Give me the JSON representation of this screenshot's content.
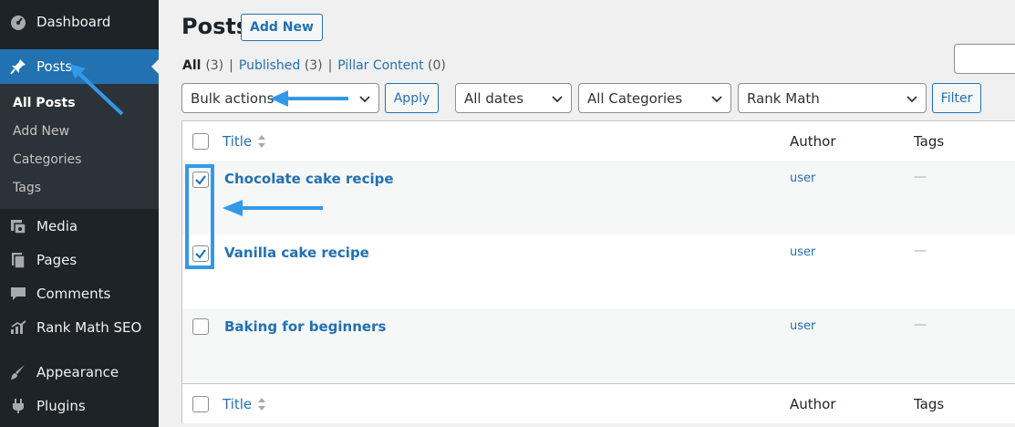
{
  "sidebar": {
    "items": [
      {
        "label": "Dashboard",
        "icon": "dashboard-icon"
      },
      {
        "label": "Posts",
        "icon": "pin-icon",
        "active": true
      },
      {
        "label": "Media",
        "icon": "media-icon"
      },
      {
        "label": "Pages",
        "icon": "pages-icon"
      },
      {
        "label": "Comments",
        "icon": "comments-icon"
      },
      {
        "label": "Rank Math SEO",
        "icon": "rank-math-icon"
      },
      {
        "label": "Appearance",
        "icon": "brush-icon"
      },
      {
        "label": "Plugins",
        "icon": "plug-icon"
      }
    ],
    "submenu": [
      "All Posts",
      "Add New",
      "Categories",
      "Tags"
    ]
  },
  "header": {
    "title": "Posts",
    "add_new": "Add New"
  },
  "views": {
    "all_label": "All",
    "all_count": "(3)",
    "published_label": "Published",
    "published_count": "(3)",
    "pillar_label": "Pillar Content",
    "pillar_count": "(0)",
    "separator": "|"
  },
  "tablenav": {
    "bulk_actions": "Bulk actions",
    "apply": "Apply",
    "dates": "All dates",
    "categories": "All Categories",
    "rank_math": "Rank Math",
    "filter": "Filter"
  },
  "table": {
    "columns": {
      "title": "Title",
      "author": "Author",
      "tags": "Tags"
    },
    "rows": [
      {
        "title": "Chocolate cake recipe",
        "author": "user",
        "tags": "—",
        "checked": true
      },
      {
        "title": "Vanilla cake recipe",
        "author": "user",
        "tags": "—",
        "checked": true
      },
      {
        "title": "Baking for beginners",
        "author": "user",
        "tags": "—",
        "checked": false
      }
    ]
  },
  "colors": {
    "sidebar_bg": "#1d2327",
    "accent": "#2271b1",
    "annotation": "#3399e6"
  }
}
